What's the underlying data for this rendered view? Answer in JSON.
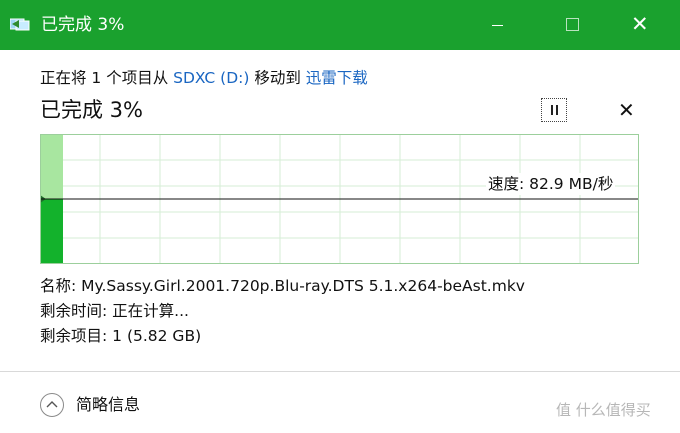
{
  "window": {
    "title": "已完成 3%",
    "accent_color": "#1aa12e",
    "icon": "file-transfer-icon",
    "minimize_icon": "minimize-icon",
    "maximize_icon": "maximize-icon",
    "close_icon": "close-icon",
    "close_glyph": "✕"
  },
  "operation": {
    "prefix": "正在将 1 个项目从 ",
    "source": "SDXC (D:)",
    "middle": " 移动到 ",
    "destination": "迅雷下载",
    "link_color": "#1a66c2"
  },
  "status": {
    "progress_text": "已完成 3%",
    "progress_fraction": 0.03,
    "pause_icon": "pause-icon",
    "cancel_icon": "close-icon",
    "cancel_glyph": "✕"
  },
  "graph": {
    "speed_label": "速度: 82.9 MB/秒",
    "fill_color": "#a8e6a0",
    "bar_color": "#13b22c",
    "grid_color": "#d6eed6",
    "border_color": "#9ccf9c"
  },
  "details": {
    "name_label": "名称: ",
    "name_value": "My.Sassy.Girl.2001.720p.Blu-ray.DTS 5.1.x264-beAst.mkv",
    "time_label": "剩余时间: ",
    "time_value": "正在计算...",
    "items_label": "剩余项目: ",
    "items_value": "1 (5.82 GB)"
  },
  "footer": {
    "toggle_icon": "chevron-up-icon",
    "toggle_label": "简略信息"
  },
  "watermark": {
    "text": "值 什么值得买",
    "icon": "smzdm-logo-icon"
  }
}
